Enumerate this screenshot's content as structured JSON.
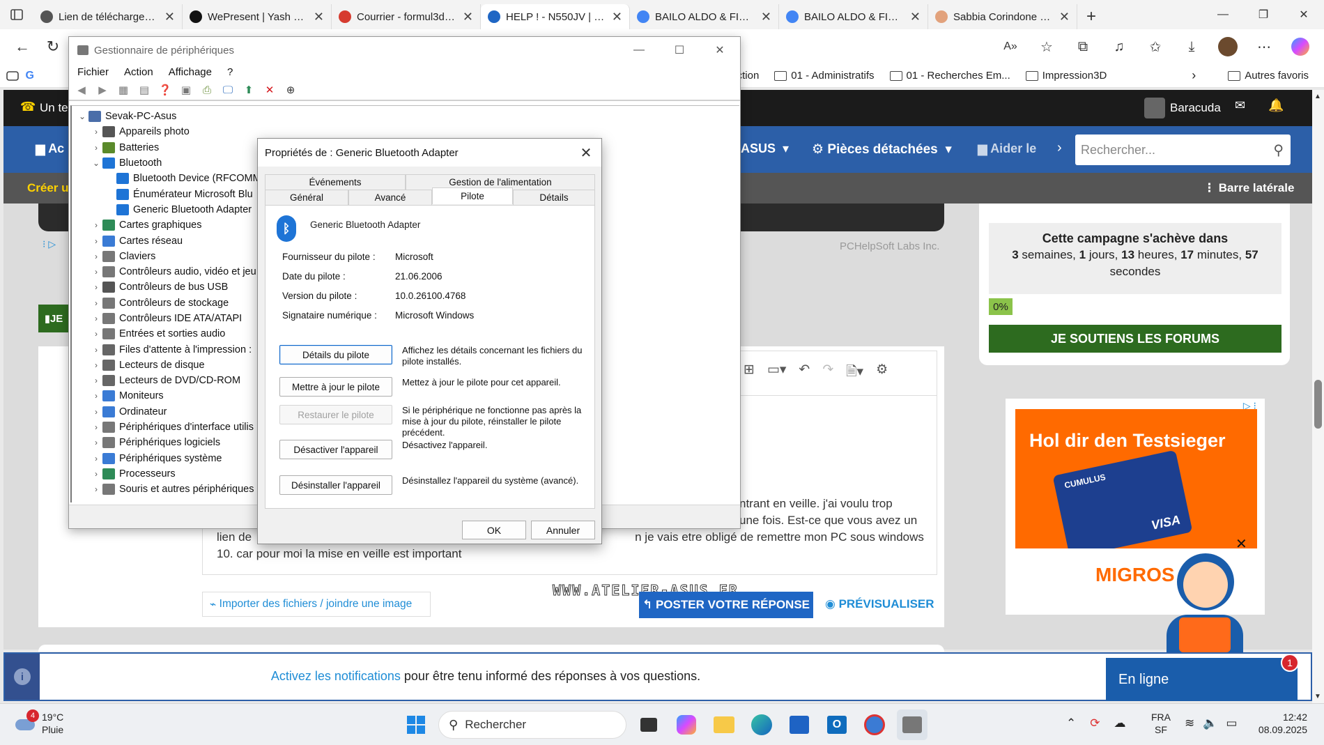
{
  "browser": {
    "tabs": [
      {
        "title": "Lien de téléchargement",
        "color": "#555555"
      },
      {
        "title": "WePresent | Yash Sheth",
        "color": "#111111"
      },
      {
        "title": "Courrier - formul3d@b",
        "color": "#d63b2f"
      },
      {
        "title": "HELP ! - N550JV | Le fo",
        "color": "#1f66c4"
      },
      {
        "title": "BAILO ALDO & FIGLIO",
        "color": "#4285f4"
      },
      {
        "title": "BAILO ALDO & FIGLIO",
        "color": "#4285f4"
      },
      {
        "title": "Sabbia Corindone per",
        "color": "#e2a27c"
      }
    ],
    "active_tab_index": 3,
    "favorites": [
      "G",
      "duction",
      "01 - Administratifs",
      "01 - Recherches Em...",
      "Impression3D",
      "Autres favoris"
    ]
  },
  "site": {
    "topbar_left": "Un te",
    "user": "Baracuda",
    "nav": [
      "Ac",
      "ASUS",
      "Pièces détachées",
      "Aider le"
    ],
    "search_placeholder": "Rechercher...",
    "sub_left": "Créer u",
    "sidebar_toggle": "Barre latérale",
    "pchelpsoft": "PCHelpSoft Labs Inc.",
    "campaign_title": "Cette campagne s'achève dans",
    "campaign_n1": "3",
    "campaign_u1": " semaines, ",
    "campaign_n2": "1",
    "campaign_u2": " jours, ",
    "campaign_n3": "13",
    "campaign_u3": " heures, ",
    "campaign_n4": "17",
    "campaign_u4": " minutes, ",
    "campaign_n5": "57",
    "campaign_seconds": "secondes",
    "campaign_percent": "0%",
    "support_button": "JE SOUTIENS LES FORUMS",
    "post_line1": "ntrant en veille. j'ai voulu trop",
    "post_line2": "une fois. Est-ce que vous avez un",
    "post_line3_a": "lien de",
    "post_line3_b": "n je vais etre obligé de remettre mon PC sous windows",
    "post_line4": "10. car pour moi la mise en veille est important",
    "watermark": "WWW.ATELIER-ASUS.FR",
    "import_link": "Importer des fichiers / joindre une image",
    "post_button": "POSTER VOTRE RÉPONSE",
    "preview_button": "PRÉVISUALISER",
    "left_button": "JE",
    "ad_headline": "Hol dir den Testsieger",
    "ad_card": "CUMULUS",
    "ad_visa": "VISA",
    "ad_brand": "MIGROS",
    "notif_link": "Activez les notifications",
    "notif_text": " pour être tenu informé des réponses à vos questions.",
    "online": "En ligne",
    "online_badge": "1"
  },
  "device_manager": {
    "title": "Gestionnaire de périphériques",
    "menu": [
      "Fichier",
      "Action",
      "Affichage",
      "?"
    ],
    "tree": [
      {
        "label": "Sevak-PC-Asus",
        "level": 0,
        "exp": "v",
        "color": "#4a6ea9"
      },
      {
        "label": "Appareils photo",
        "level": 1,
        "exp": ">",
        "color": "#555555"
      },
      {
        "label": "Batteries",
        "level": 1,
        "exp": ">",
        "color": "#5a8a2b"
      },
      {
        "label": "Bluetooth",
        "level": 1,
        "exp": "v",
        "color": "#1e74d6"
      },
      {
        "label": "Bluetooth Device (RFCOMM",
        "level": 2,
        "exp": "",
        "color": "#1e74d6"
      },
      {
        "label": "Énumérateur Microsoft Blu",
        "level": 2,
        "exp": "",
        "color": "#1e74d6"
      },
      {
        "label": "Generic Bluetooth Adapter",
        "level": 2,
        "exp": "",
        "color": "#1e74d6"
      },
      {
        "label": "Cartes graphiques",
        "level": 1,
        "exp": ">",
        "color": "#2e8b57"
      },
      {
        "label": "Cartes réseau",
        "level": 1,
        "exp": ">",
        "color": "#3a7bd5"
      },
      {
        "label": "Claviers",
        "level": 1,
        "exp": ">",
        "color": "#777777"
      },
      {
        "label": "Contrôleurs audio, vidéo et jeu",
        "level": 1,
        "exp": ">",
        "color": "#777777"
      },
      {
        "label": "Contrôleurs de bus USB",
        "level": 1,
        "exp": ">",
        "color": "#555555"
      },
      {
        "label": "Contrôleurs de stockage",
        "level": 1,
        "exp": ">",
        "color": "#777777"
      },
      {
        "label": "Contrôleurs IDE ATA/ATAPI",
        "level": 1,
        "exp": ">",
        "color": "#777777"
      },
      {
        "label": "Entrées et sorties audio",
        "level": 1,
        "exp": ">",
        "color": "#777777"
      },
      {
        "label": "Files d'attente à l'impression :",
        "level": 1,
        "exp": ">",
        "color": "#666666"
      },
      {
        "label": "Lecteurs de disque",
        "level": 1,
        "exp": ">",
        "color": "#666666"
      },
      {
        "label": "Lecteurs de DVD/CD-ROM",
        "level": 1,
        "exp": ">",
        "color": "#666666"
      },
      {
        "label": "Moniteurs",
        "level": 1,
        "exp": ">",
        "color": "#3a7bd5"
      },
      {
        "label": "Ordinateur",
        "level": 1,
        "exp": ">",
        "color": "#3a7bd5"
      },
      {
        "label": "Périphériques d'interface utilis",
        "level": 1,
        "exp": ">",
        "color": "#777777"
      },
      {
        "label": "Périphériques logiciels",
        "level": 1,
        "exp": ">",
        "color": "#777777"
      },
      {
        "label": "Périphériques système",
        "level": 1,
        "exp": ">",
        "color": "#3a7bd5"
      },
      {
        "label": "Processeurs",
        "level": 1,
        "exp": ">",
        "color": "#2e8b57"
      },
      {
        "label": "Souris et autres périphériques",
        "level": 1,
        "exp": ">",
        "color": "#777777"
      }
    ]
  },
  "dialog": {
    "title": "Propriétés de : Generic Bluetooth Adapter",
    "tabs_top": [
      "Événements",
      "Gestion de l'alimentation"
    ],
    "tabs_bottom": [
      "Général",
      "Avancé",
      "Pilote",
      "Détails"
    ],
    "device_name": "Generic Bluetooth Adapter",
    "fields": [
      {
        "k": "Fournisseur du pilote :",
        "v": "Microsoft"
      },
      {
        "k": "Date du pilote :",
        "v": "21.06.2006"
      },
      {
        "k": "Version du pilote :",
        "v": "10.0.26100.4768"
      },
      {
        "k": "Signataire numérique :",
        "v": "Microsoft Windows"
      }
    ],
    "btn_details": "Détails du pilote",
    "desc_details": "Affichez les détails concernant les fichiers du pilote installés.",
    "btn_update": "Mettre à jour le pilote",
    "desc_update": "Mettez à jour le pilote pour cet appareil.",
    "btn_rollback": "Restaurer le pilote",
    "desc_rollback": "Si le périphérique ne fonctionne pas après la mise à jour du pilote, réinstaller le pilote précédent.",
    "btn_disable": "Désactiver l'appareil",
    "desc_disable": "Désactivez l'appareil.",
    "btn_uninstall": "Désinstaller l'appareil",
    "desc_uninstall": "Désinstallez l'appareil du système (avancé).",
    "ok": "OK",
    "cancel": "Annuler"
  },
  "taskbar": {
    "weather_badge": "4",
    "temp": "19°C",
    "cond": "Pluie",
    "search": "Rechercher",
    "lang1": "FRA",
    "lang2": "SF",
    "time": "12:42",
    "date": "08.09.2025"
  }
}
